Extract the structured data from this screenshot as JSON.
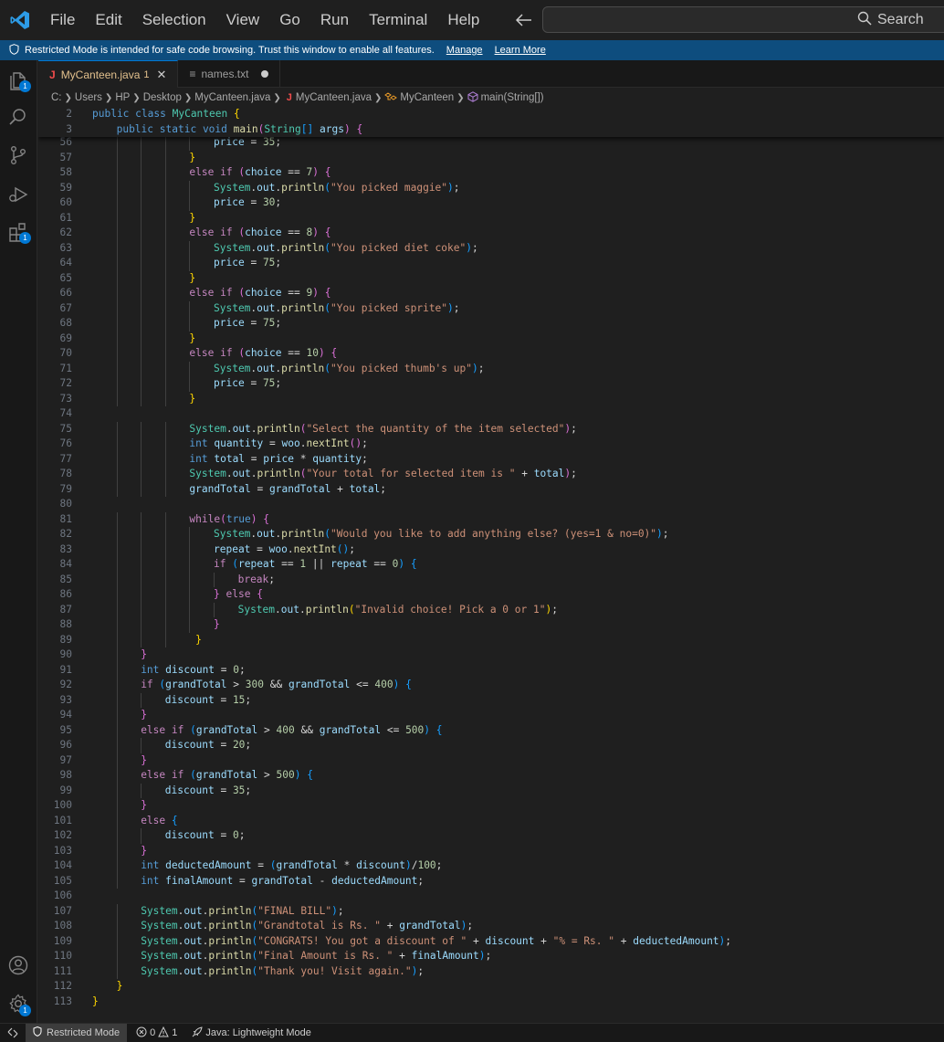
{
  "menu": [
    "File",
    "Edit",
    "Selection",
    "View",
    "Go",
    "Run",
    "Terminal",
    "Help"
  ],
  "search": {
    "label": "Search"
  },
  "banner": {
    "message": "Restricted Mode is intended for safe code browsing. Trust this window to enable all features.",
    "manage": "Manage",
    "learn_more": "Learn More"
  },
  "activity": {
    "explorer_badge": "1",
    "extensions_badge": "1",
    "settings_badge": "1"
  },
  "tabs": [
    {
      "label": "MyCanteen.java",
      "modified_count": "1",
      "active": true
    },
    {
      "label": "names.txt",
      "active": false
    }
  ],
  "breadcrumb": [
    "C:",
    "Users",
    "HP",
    "Desktop",
    "MyCanteen.java",
    "MyCanteen.java",
    "MyCanteen",
    "main(String[])"
  ],
  "sticky_lines": [
    {
      "no": "2",
      "indent": 0,
      "text": "public class MyCanteen {"
    },
    {
      "no": "3",
      "indent": 1,
      "text": "public static void main(String[] args) {"
    }
  ],
  "code_lines": [
    {
      "no": "56",
      "indent": 5,
      "text": "price = 35;"
    },
    {
      "no": "57",
      "indent": 4,
      "text": "}"
    },
    {
      "no": "58",
      "indent": 4,
      "text": "else if (choice == 7) {"
    },
    {
      "no": "59",
      "indent": 5,
      "text": "System.out.println(\"You picked maggie\");"
    },
    {
      "no": "60",
      "indent": 5,
      "text": "price = 30;"
    },
    {
      "no": "61",
      "indent": 4,
      "text": "}"
    },
    {
      "no": "62",
      "indent": 4,
      "text": "else if (choice == 8) {"
    },
    {
      "no": "63",
      "indent": 5,
      "text": "System.out.println(\"You picked diet coke\");"
    },
    {
      "no": "64",
      "indent": 5,
      "text": "price = 75;"
    },
    {
      "no": "65",
      "indent": 4,
      "text": "}"
    },
    {
      "no": "66",
      "indent": 4,
      "text": "else if (choice == 9) {"
    },
    {
      "no": "67",
      "indent": 5,
      "text": "System.out.println(\"You picked sprite\");"
    },
    {
      "no": "68",
      "indent": 5,
      "text": "price = 75;"
    },
    {
      "no": "69",
      "indent": 4,
      "text": "}"
    },
    {
      "no": "70",
      "indent": 4,
      "text": "else if (choice == 10) {"
    },
    {
      "no": "71",
      "indent": 5,
      "text": "System.out.println(\"You picked thumb's up\");"
    },
    {
      "no": "72",
      "indent": 5,
      "text": "price = 75;"
    },
    {
      "no": "73",
      "indent": 4,
      "text": "}"
    },
    {
      "no": "74",
      "indent": 0,
      "text": ""
    },
    {
      "no": "75",
      "indent": 4,
      "text": "System.out.println(\"Select the quantity of the item selected\");"
    },
    {
      "no": "76",
      "indent": 4,
      "text": "int quantity = woo.nextInt();"
    },
    {
      "no": "77",
      "indent": 4,
      "text": "int total = price * quantity;"
    },
    {
      "no": "78",
      "indent": 4,
      "text": "System.out.println(\"Your total for selected item is \" + total);"
    },
    {
      "no": "79",
      "indent": 4,
      "text": "grandTotal = grandTotal + total;"
    },
    {
      "no": "80",
      "indent": 0,
      "text": ""
    },
    {
      "no": "81",
      "indent": 4,
      "text": "while(true) {"
    },
    {
      "no": "82",
      "indent": 5,
      "text": "System.out.println(\"Would you like to add anything else? (yes=1 & no=0)\");"
    },
    {
      "no": "83",
      "indent": 5,
      "text": "repeat = woo.nextInt();"
    },
    {
      "no": "84",
      "indent": 5,
      "text": "if (repeat == 1 || repeat == 0) {"
    },
    {
      "no": "85",
      "indent": 6,
      "text": "break;"
    },
    {
      "no": "86",
      "indent": 5,
      "text": "} else {"
    },
    {
      "no": "87",
      "indent": 6,
      "text": "System.out.println(\"Invalid choice! Pick a 0 or 1\");"
    },
    {
      "no": "88",
      "indent": 5,
      "text": "}"
    },
    {
      "no": "89",
      "indent": 4,
      "text": " }"
    },
    {
      "no": "90",
      "indent": 2,
      "text": "}"
    },
    {
      "no": "91",
      "indent": 2,
      "text": "int discount = 0;"
    },
    {
      "no": "92",
      "indent": 2,
      "text": "if (grandTotal > 300 && grandTotal <= 400) {"
    },
    {
      "no": "93",
      "indent": 3,
      "text": "discount = 15;"
    },
    {
      "no": "94",
      "indent": 2,
      "text": "}"
    },
    {
      "no": "95",
      "indent": 2,
      "text": "else if (grandTotal > 400 && grandTotal <= 500) {"
    },
    {
      "no": "96",
      "indent": 3,
      "text": "discount = 20;"
    },
    {
      "no": "97",
      "indent": 2,
      "text": "}"
    },
    {
      "no": "98",
      "indent": 2,
      "text": "else if (grandTotal > 500) {"
    },
    {
      "no": "99",
      "indent": 3,
      "text": "discount = 35;"
    },
    {
      "no": "100",
      "indent": 2,
      "text": "}"
    },
    {
      "no": "101",
      "indent": 2,
      "text": "else {"
    },
    {
      "no": "102",
      "indent": 3,
      "text": "discount = 0;"
    },
    {
      "no": "103",
      "indent": 2,
      "text": "}"
    },
    {
      "no": "104",
      "indent": 2,
      "text": "int deductedAmount = (grandTotal * discount)/100;"
    },
    {
      "no": "105",
      "indent": 2,
      "text": "int finalAmount = grandTotal - deductedAmount;"
    },
    {
      "no": "106",
      "indent": 0,
      "text": ""
    },
    {
      "no": "107",
      "indent": 2,
      "text": "System.out.println(\"FINAL BILL\");"
    },
    {
      "no": "108",
      "indent": 2,
      "text": "System.out.println(\"Grandtotal is Rs. \" + grandTotal);"
    },
    {
      "no": "109",
      "indent": 2,
      "text": "System.out.println(\"CONGRATS! You got a discount of \" + discount + \"% = Rs. \" + deductedAmount);"
    },
    {
      "no": "110",
      "indent": 2,
      "text": "System.out.println(\"Final Amount is Rs. \" + finalAmount);"
    },
    {
      "no": "111",
      "indent": 2,
      "text": "System.out.println(\"Thank you! Visit again.\");"
    },
    {
      "no": "112",
      "indent": 1,
      "text": "}"
    },
    {
      "no": "113",
      "indent": 0,
      "text": "}"
    }
  ],
  "status": {
    "restricted": "Restricted Mode",
    "errors": "0",
    "warnings": "1",
    "java": "Java: Lightweight Mode"
  },
  "colors": {
    "accent": "#0078d4",
    "banner": "#0e4d7e",
    "editor_bg": "#1f1f1f"
  }
}
